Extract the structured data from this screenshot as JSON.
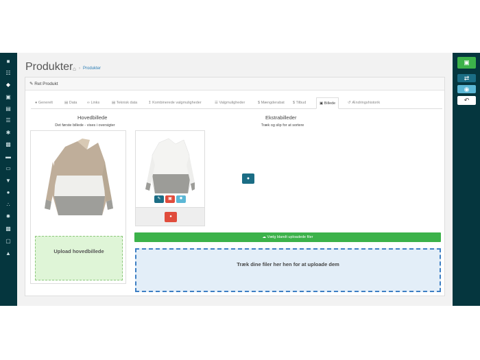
{
  "page": {
    "title": "Produkter",
    "breadcrumb_link": "Produkter"
  },
  "card": {
    "header": "Ret Produkt"
  },
  "tabs": [
    {
      "label": "Generelt"
    },
    {
      "label": "Data"
    },
    {
      "label": "Links"
    },
    {
      "label": "Teknisk data"
    },
    {
      "label": "Kombinerede valgmuligheder"
    },
    {
      "label": "Valgmuligheder"
    },
    {
      "label": "Mængderabat"
    },
    {
      "label": "Tilbud"
    },
    {
      "label": "Billede"
    },
    {
      "label": "Ændringshistorik"
    }
  ],
  "main_image": {
    "heading": "Hovedbillede",
    "subtitle": "Det første billede - vises i oversigter",
    "upload_label": "Upload hovedbillede"
  },
  "extra_images": {
    "heading": "Ekstrabilleder",
    "subtitle": "Træk og slip for at sortere",
    "select_button": "Vælg blandt uploadede filer",
    "dropzone_label": "Træk dine filer her hen for at uploade dem"
  },
  "colors": {
    "sidebar": "#05363e",
    "save": "#3cb24a",
    "edit": "#1b6d85",
    "delete": "#e04c3c"
  }
}
